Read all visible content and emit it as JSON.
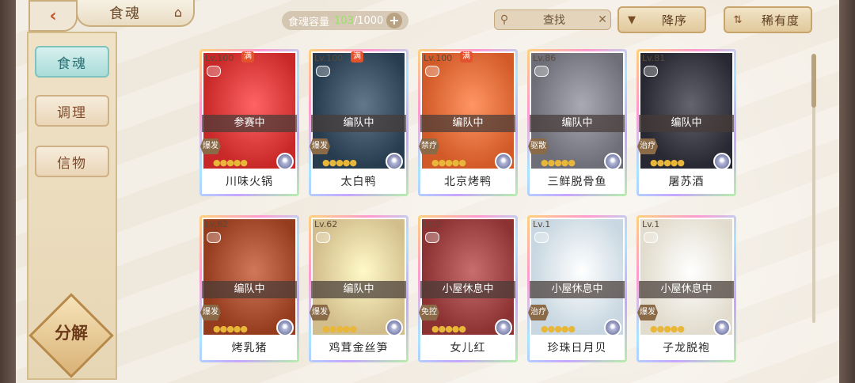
{
  "header": {
    "back_icon": "back-arrow-icon",
    "title": "食魂",
    "capacity_label": "食魂容量",
    "capacity_current": "103",
    "capacity_sep": "/1000",
    "capacity_add": "+",
    "search_placeholder": "查找",
    "search_clear": "✕",
    "sort_order_label": "降序",
    "sort_by_label": "稀有度"
  },
  "sidebar": {
    "items": [
      {
        "label": "食魂",
        "active": true
      },
      {
        "label": "调理",
        "active": false
      },
      {
        "label": "信物",
        "active": false
      }
    ],
    "decompose_label": "分解"
  },
  "cards": [
    {
      "level": "Lv.100",
      "full": "满",
      "status": "参赛中",
      "type": "爆发",
      "stars": "●●●●●",
      "name": "川味火锅"
    },
    {
      "level": "Lv.100",
      "full": "满",
      "status": "编队中",
      "type": "爆发",
      "stars": "●●●●●",
      "name": "太白鸭"
    },
    {
      "level": "Lv.100",
      "full": "满",
      "status": "编队中",
      "type": "禁疗",
      "stars": "●●●●●",
      "name": "北京烤鸭"
    },
    {
      "level": "Lv.86",
      "full": "",
      "status": "编队中",
      "type": "驱散",
      "stars": "●●●●●",
      "name": "三鲜脱骨鱼"
    },
    {
      "level": "Lv.81",
      "full": "",
      "status": "编队中",
      "type": "治疗",
      "stars": "●●●●●",
      "name": "屠苏酒"
    },
    {
      "level": "Lv.62",
      "full": "",
      "status": "编队中",
      "type": "爆发",
      "stars": "●●●●●",
      "name": "烤乳猪"
    },
    {
      "level": "Lv.62",
      "full": "",
      "status": "编队中",
      "type": "爆发",
      "stars": "●●●●●",
      "name": "鸡茸金丝笋"
    },
    {
      "level": "Lv.1",
      "full": "",
      "status": "小屋休息中",
      "type": "免控",
      "stars": "●●●●●",
      "name": "女儿红"
    },
    {
      "level": "Lv.1",
      "full": "",
      "status": "小屋休息中",
      "type": "治疗",
      "stars": "●●●●●",
      "name": "珍珠日月贝"
    },
    {
      "level": "Lv.1",
      "full": "",
      "status": "小屋休息中",
      "type": "爆发",
      "stars": "●●●●●",
      "name": "子龙脱袍"
    }
  ],
  "colors": {
    "accent_teal": "#a9dcd8",
    "capacity_current": "#9be06a",
    "frame": "#5a4a42"
  }
}
